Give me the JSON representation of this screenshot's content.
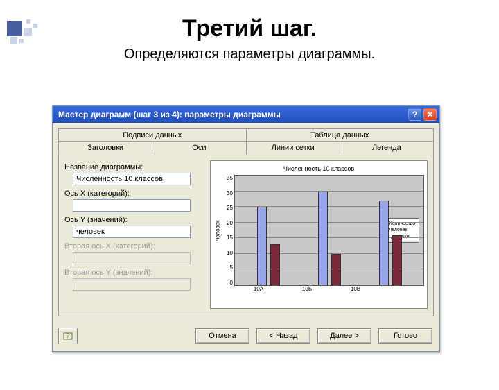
{
  "slide": {
    "title": "Третий шаг.",
    "subtitle": "Определяются параметры диаграммы."
  },
  "dialog": {
    "title": "Мастер диаграмм (шаг 3 из 4): параметры диаграммы",
    "help_glyph": "?",
    "close_glyph": "✕",
    "tabs_top": [
      "Подписи данных",
      "Таблица данных"
    ],
    "tabs_bot": [
      "Заголовки",
      "Оси",
      "Линии сетки",
      "Легенда"
    ],
    "fields": {
      "chart_title_label": "Название диаграммы:",
      "chart_title_value": "Численность 10 классов",
      "x_label": "Ось X (категорий):",
      "x_value": "",
      "y_label": "Ось Y (значений):",
      "y_value": "человек",
      "x2_label": "Вторая ось X (категорий):",
      "y2_label": "Вторая ось Y (значений):"
    },
    "buttons": {
      "cancel": "Отмена",
      "back": "< Назад",
      "next": "Далее >",
      "finish": "Готово"
    }
  },
  "chart_data": {
    "type": "bar",
    "title": "Численность 10 классов",
    "ylabel": "человек",
    "xlabel": "",
    "categories": [
      "10А",
      "10Б",
      "10В"
    ],
    "series": [
      {
        "name": "Количество человек",
        "values": [
          25,
          30,
          27
        ]
      },
      {
        "name": "Девочки",
        "values": [
          13,
          10,
          16
        ]
      }
    ],
    "ylim": [
      0,
      35
    ],
    "yticks": [
      0,
      5,
      10,
      15,
      20,
      25,
      30,
      35
    ]
  }
}
